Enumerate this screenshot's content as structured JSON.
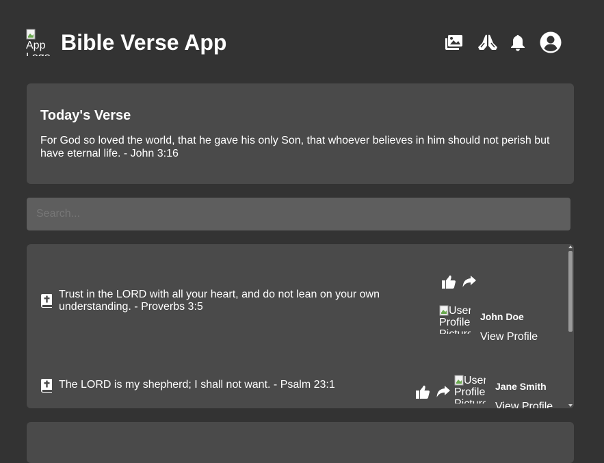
{
  "header": {
    "logo_alt": "App Logo",
    "title": "Bible Verse App",
    "icons": [
      "gallery-icon",
      "praying-hands-icon",
      "bell-icon",
      "user-circle-icon"
    ]
  },
  "today": {
    "heading": "Today's Verse",
    "text": "For God so loved the world, that he gave his only Son, that whoever believes in him should not perish but have eternal life. - John 3:16"
  },
  "search": {
    "placeholder": "Search..."
  },
  "verses": [
    {
      "text": "Trust in the LORD with all your heart, and do not lean on your own understanding. - Proverbs 3:5",
      "user": "John Doe",
      "pic_alt": "User Profile Picture",
      "link": "View Profile"
    },
    {
      "text": "The LORD is my shepherd; I shall not want. - Psalm 23:1",
      "user": "Jane Smith",
      "pic_alt": "User Profile Picture",
      "link": "View Profile"
    }
  ],
  "colors": {
    "background": "#333333",
    "card": "#4a4a4a",
    "search": "#5e5e5e",
    "text": "#ffffff"
  }
}
